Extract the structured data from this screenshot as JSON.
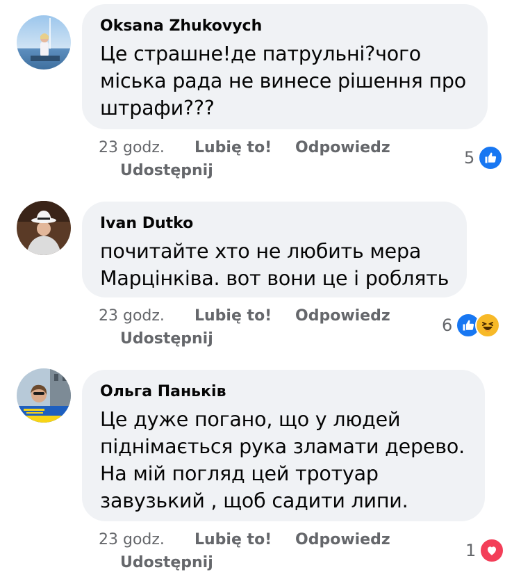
{
  "colors": {
    "bubble": "#f0f2f5",
    "meta_text": "#65676b",
    "body_text": "#050505",
    "like_blue": "#1877f2",
    "haha_yellow": "#f7b928",
    "love_red": "#f33e58"
  },
  "comments": [
    {
      "author": "Oksana Zhukovych",
      "text": "Це страшне!де патрульні?чого\nміська рада не винесе рішення про\nштрафи???",
      "time": "23 godz.",
      "like_label": "Lubię to!",
      "reply_label": "Odpowiedz",
      "share_label": "Udostępnij",
      "reaction_count": "5",
      "reactions": [
        "like-icon"
      ]
    },
    {
      "author": "Ivan Dutko",
      "text": "почитайте хто не любить мера\nМарцінківа. вот вони це і роблять",
      "time": "23 godz.",
      "like_label": "Lubię to!",
      "reply_label": "Odpowiedz",
      "share_label": "Udostępnij",
      "reaction_count": "6",
      "reactions": [
        "like-icon",
        "haha-icon"
      ]
    },
    {
      "author": "Ольга Паньків",
      "text": "Це дуже погано, що у людей\nпіднімається рука зламати дерево.\nНа мій погляд цей тротуар\nзавузький , щоб садити липи.",
      "time": "23 godz.",
      "like_label": "Lubię to!",
      "reply_label": "Odpowiedz",
      "share_label": "Udostępnij",
      "reaction_count": "1",
      "reactions": [
        "love-icon"
      ]
    }
  ]
}
